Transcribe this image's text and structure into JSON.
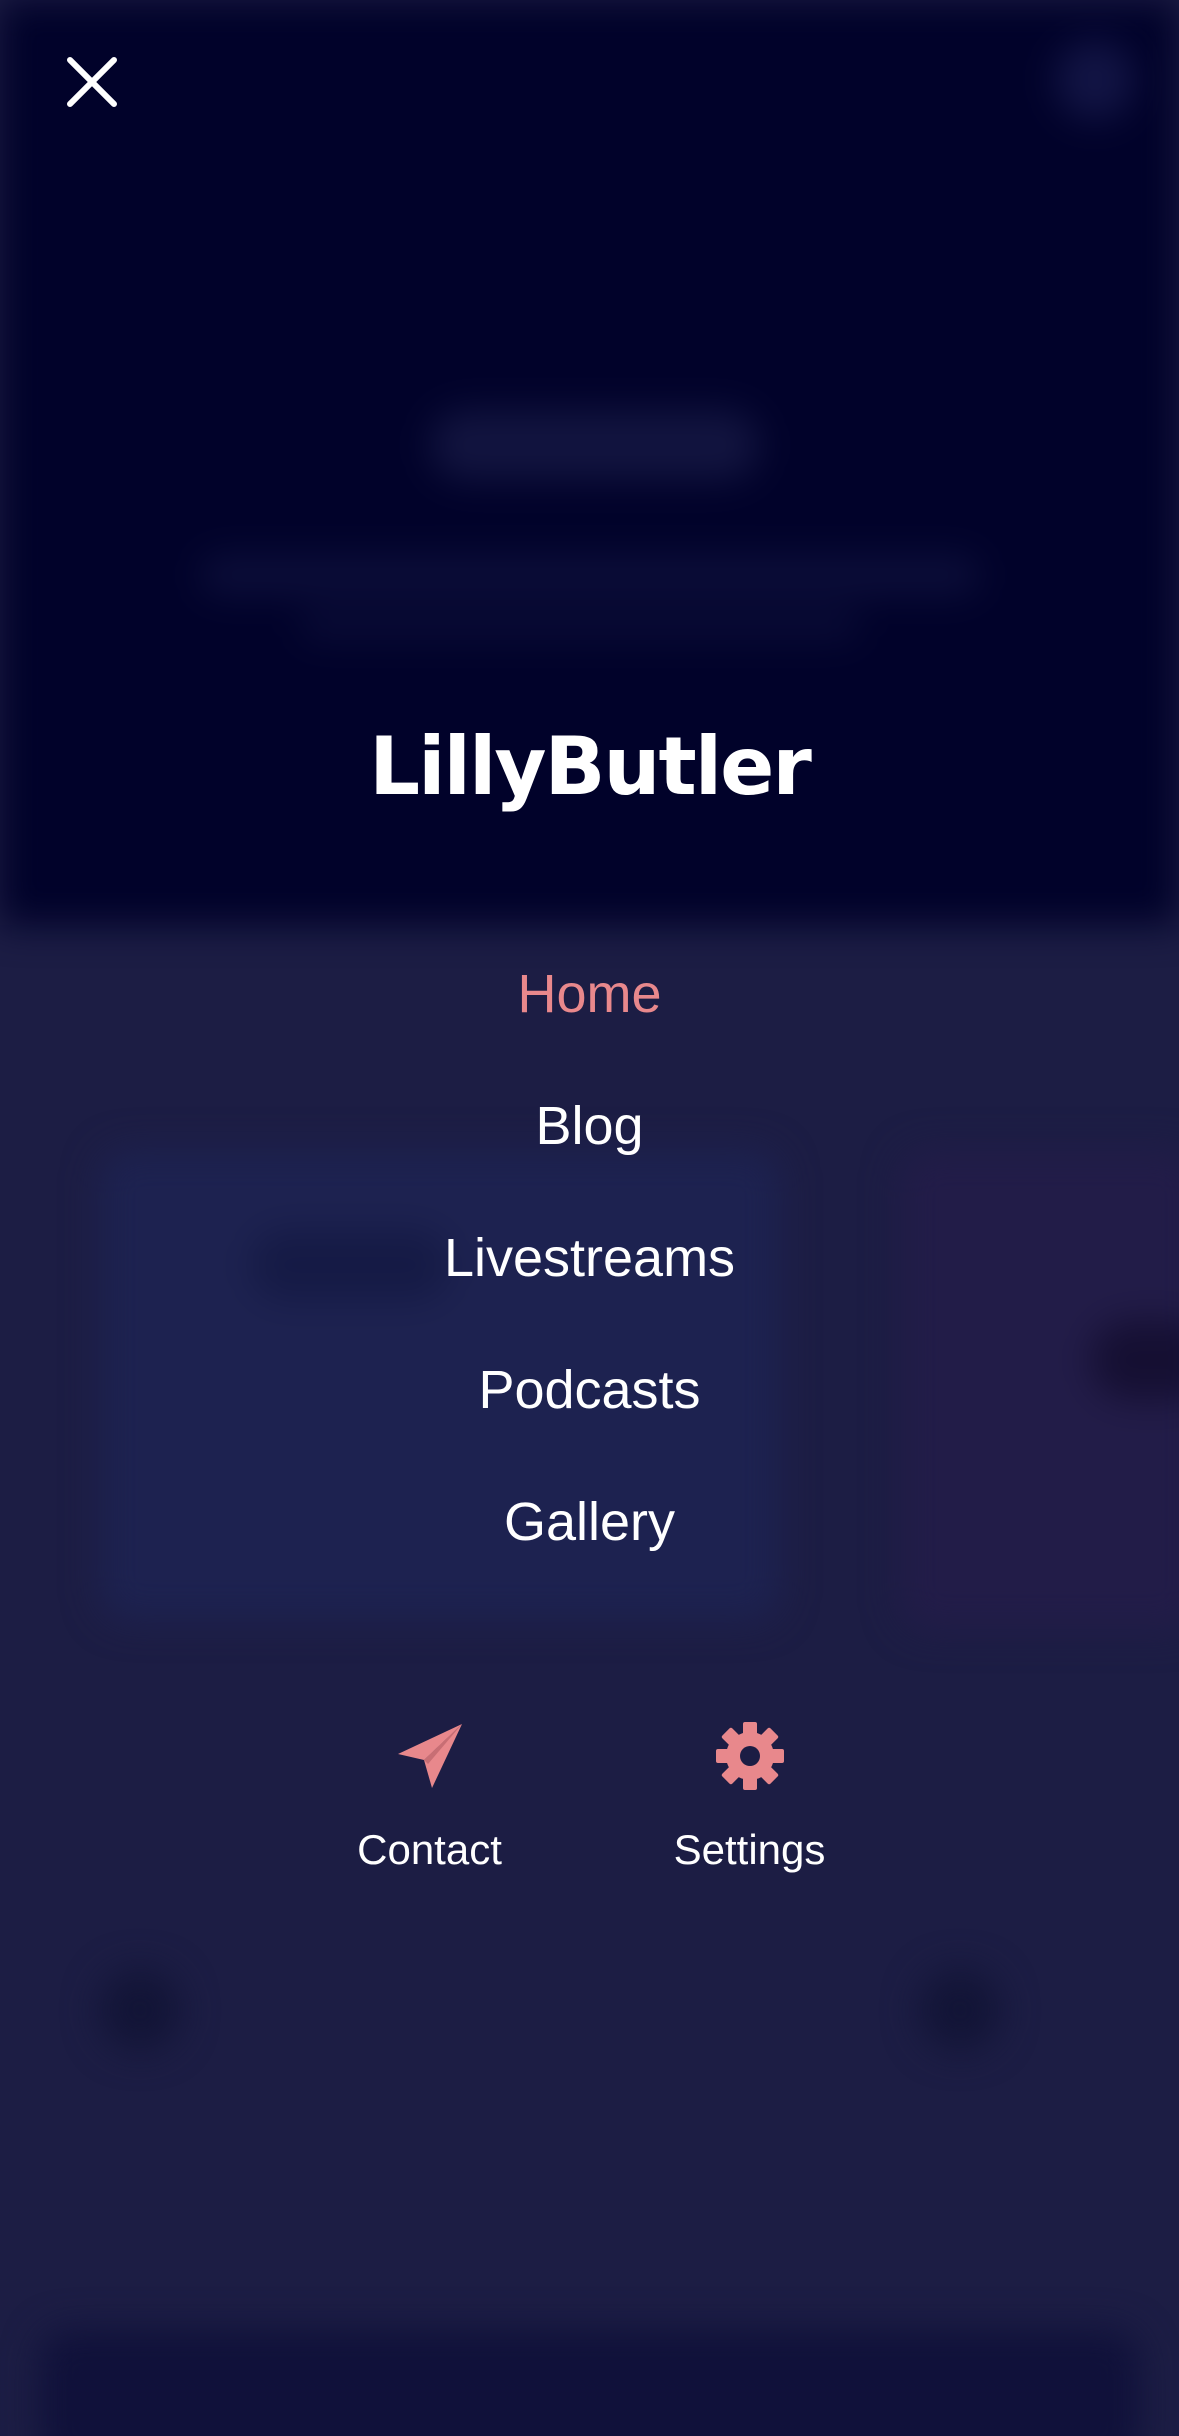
{
  "brand": {
    "name": "LillyButler"
  },
  "nav": {
    "items": [
      {
        "label": "Home",
        "active": true
      },
      {
        "label": "Blog",
        "active": false
      },
      {
        "label": "Livestreams",
        "active": false
      },
      {
        "label": "Podcasts",
        "active": false
      },
      {
        "label": "Gallery",
        "active": false
      }
    ]
  },
  "actions": {
    "contact": {
      "label": "Contact",
      "icon": "paper-plane-icon"
    },
    "settings": {
      "label": "Settings",
      "icon": "gear-icon"
    }
  },
  "controls": {
    "close_icon": "close-icon"
  },
  "colors": {
    "accent": "#e8888c",
    "overlay_top": "#01022a",
    "overlay_bottom": "#1c1d44",
    "text": "#ffffff"
  }
}
